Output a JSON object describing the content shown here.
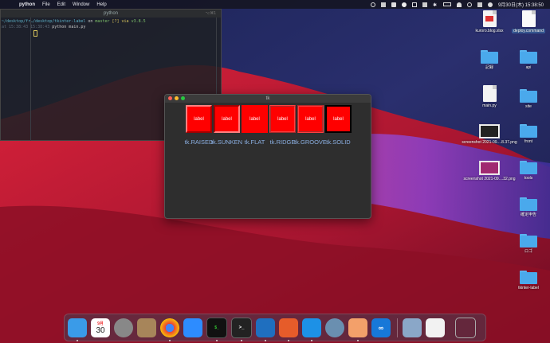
{
  "menubar": {
    "app_name": "python",
    "menus": [
      "File",
      "Edit",
      "Window",
      "Help"
    ],
    "datetime": "9月30日(木) 15:38:50"
  },
  "terminal": {
    "title": "python",
    "shortcut": "⌥⌘1",
    "line1_path": "~/desktop/fr…/desktop/tkinter-label",
    "line1_on": "on",
    "line1_branch": "master",
    "line1_status": "[?] via",
    "line1_version": "v3.8.5",
    "line2_time": "at 15:38:43 15:38:43",
    "line2_cmd": "python main.py"
  },
  "tk_window": {
    "title": "tk",
    "labels": [
      {
        "text": "label",
        "relief": "tk.RAISED"
      },
      {
        "text": "label",
        "relief": "tk.SUNKEN"
      },
      {
        "text": "label",
        "relief": "tk.FLAT"
      },
      {
        "text": "label",
        "relief": "tk.RIDGE"
      },
      {
        "text": "label",
        "relief": "tk.GROOVE"
      },
      {
        "text": "label",
        "relief": "tk.SOLID"
      }
    ]
  },
  "desktop": {
    "icons": [
      {
        "name": "kuroro.blog.xlsx"
      },
      {
        "name": "deploy.command"
      },
      {
        "name": "記録"
      },
      {
        "name": "api"
      },
      {
        "name": "main.py"
      },
      {
        "name": "site"
      },
      {
        "name": "screenshot 2021-09....8.37.png"
      },
      {
        "name": "front"
      },
      {
        "name": "screenshot 2021-09....32.png"
      },
      {
        "name": "tools"
      },
      {
        "name": "確定申告"
      },
      {
        "name": "ロゴ"
      },
      {
        "name": "tkinter-label"
      }
    ]
  },
  "dock": {
    "calendar_month": "9月",
    "calendar_day": "30"
  },
  "colors": {
    "label_bg": "#ff0000",
    "relief_text": "#8aaee0",
    "folder": "#4aa9ec"
  }
}
